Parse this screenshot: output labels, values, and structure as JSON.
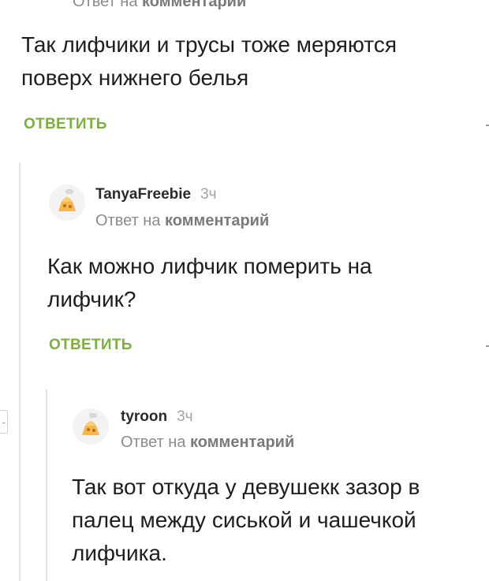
{
  "comments": [
    {
      "reply_to_prefix": "Ответ на",
      "reply_to_target": "комментарий",
      "text_lines": [
        "Так лифчики и трусы тоже меряются",
        "поверх нижнего белья"
      ],
      "reply_label": "ОТВЕТИТЬ"
    },
    {
      "author": "TanyaFreebie",
      "time": "3ч",
      "reply_to_prefix": "Ответ на",
      "reply_to_target": "комментарий",
      "text_lines": [
        "Как можно лифчик померить на",
        "лифчик?"
      ],
      "reply_label": "ОТВЕТИТЬ"
    },
    {
      "author": "tyroon",
      "time": "3ч",
      "reply_to_prefix": "Ответ на",
      "reply_to_target": "комментарий",
      "text_lines": [
        "Так вот откуда у девушекк зазор в",
        "палец между сиськой и чашечкой",
        "лифчика."
      ]
    }
  ],
  "collapse_control": "-",
  "colors": {
    "reply_green": "#7bb03a",
    "text": "#1e1e1e",
    "muted": "#8b8b8b",
    "thread_line": "#e4e4e4"
  },
  "icons": {
    "avatar": "default-avatar-icon"
  }
}
